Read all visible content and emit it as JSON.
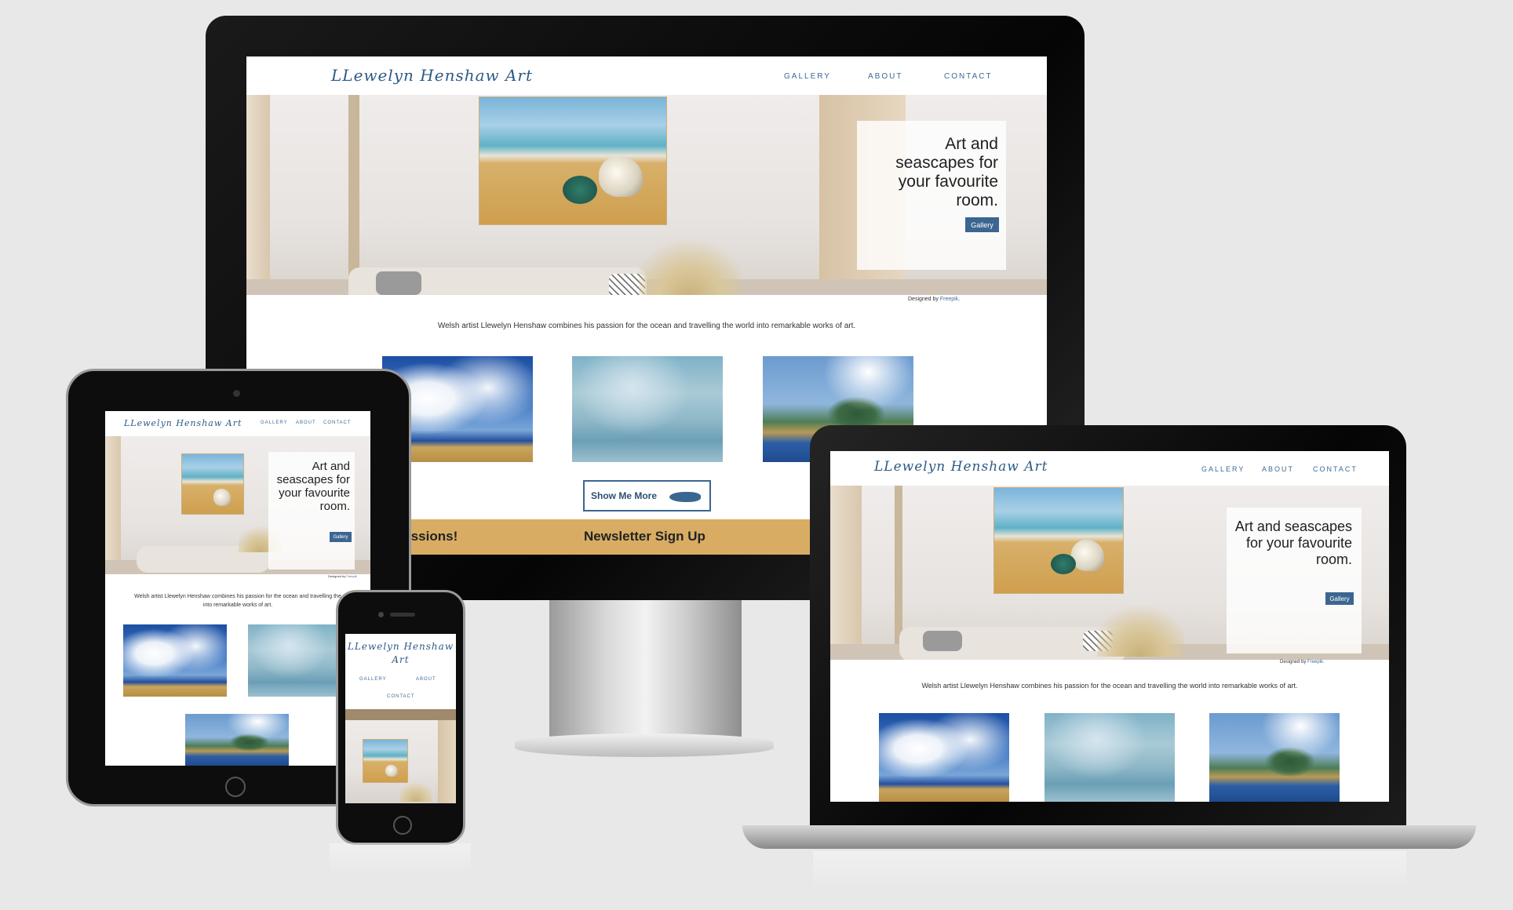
{
  "site": {
    "logo": "LLewelyn Henshaw Art",
    "logo_line1": "LLewelyn Henshaw",
    "logo_line2": "Art",
    "nav": {
      "gallery": "GALLERY",
      "about": "ABOUT",
      "contact": "CONTACT"
    },
    "hero": {
      "headline": "Art and seascapes for your favourite room.",
      "button": "Gallery"
    },
    "credit": {
      "prefix": "Designed by",
      "link": "Freepik",
      "suffix": "."
    },
    "intro": "Welsh artist Llewelyn Henshaw combines his passion for the ocean and travelling the world into remarkable works of art.",
    "intro_line1": "Welsh artist Llewelyn Henshaw combines his passion for the ocean and travelling the",
    "intro_line2": "into remarkable works of art.",
    "show_more": "Show Me More",
    "band": {
      "left": "issions!",
      "right": "Newsletter Sign Up"
    }
  },
  "colors": {
    "background": "#e8e8e8",
    "brand_blue": "#3b6690",
    "band_gold": "#d8ad63",
    "device_black": "#0d0d0d"
  },
  "icons": {
    "whale": "whale-icon",
    "home_button": "home-button-icon",
    "camera": "camera-icon"
  }
}
